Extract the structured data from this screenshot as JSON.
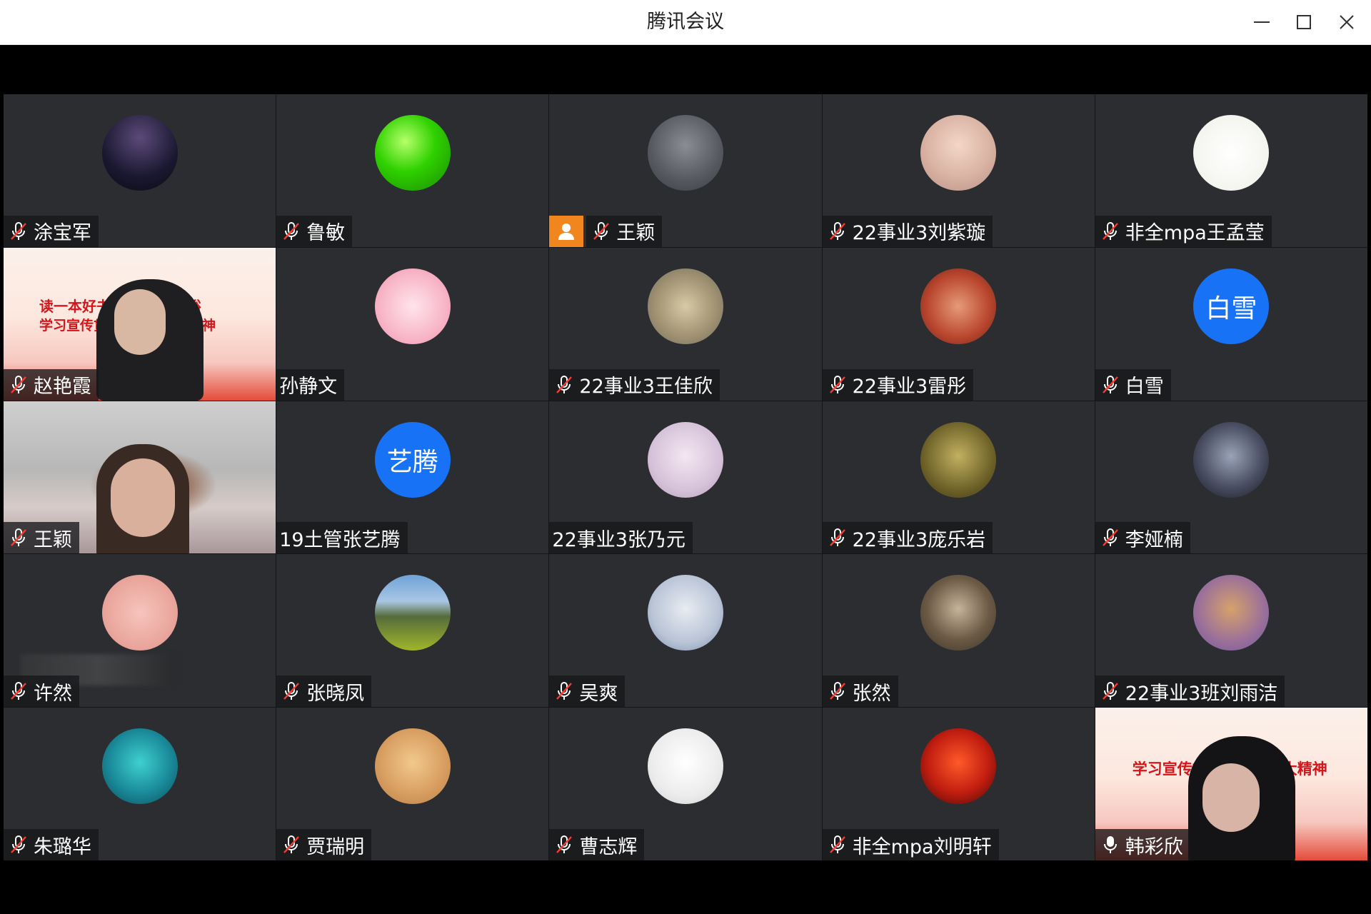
{
  "window": {
    "title": "腾讯会议",
    "controls": [
      "minimize-icon",
      "maximize-icon",
      "close-icon"
    ]
  },
  "colors": {
    "tile_bg": "#2b2d31",
    "host_badge": "#f0861d",
    "text_avatar": "#1772f5",
    "active_speaker_border": "#2fd07b"
  },
  "participants": [
    {
      "name": "涂宝军",
      "mic": "muted",
      "view": "avatar"
    },
    {
      "name": "鲁敏",
      "mic": "muted",
      "view": "avatar"
    },
    {
      "name": "王颖",
      "mic": "muted",
      "view": "avatar",
      "host": true
    },
    {
      "name": "22事业3刘紫璇",
      "mic": "muted",
      "view": "avatar"
    },
    {
      "name": "非全mpa王孟莹",
      "mic": "muted",
      "view": "avatar"
    },
    {
      "name": "赵艳霞",
      "mic": "muted",
      "view": "video"
    },
    {
      "name": "孙静文",
      "mic": "none",
      "view": "avatar"
    },
    {
      "name": "22事业3王佳欣",
      "mic": "muted",
      "view": "avatar"
    },
    {
      "name": "22事业3雷彤",
      "mic": "muted",
      "view": "avatar"
    },
    {
      "name": "白雪",
      "mic": "muted",
      "view": "text-avatar",
      "avatar_text": "白雪"
    },
    {
      "name": "王颖",
      "mic": "muted",
      "view": "video"
    },
    {
      "name": "19土管张艺腾",
      "mic": "none",
      "view": "text-avatar",
      "avatar_text": "艺腾"
    },
    {
      "name": "22事业3张乃元",
      "mic": "none",
      "view": "avatar"
    },
    {
      "name": "22事业3庞乐岩",
      "mic": "muted",
      "view": "avatar"
    },
    {
      "name": "李娅楠",
      "mic": "muted",
      "view": "avatar"
    },
    {
      "name": "许然",
      "mic": "muted",
      "view": "avatar"
    },
    {
      "name": "张晓凤",
      "mic": "muted",
      "view": "avatar"
    },
    {
      "name": "吴爽",
      "mic": "muted",
      "view": "avatar"
    },
    {
      "name": "张然",
      "mic": "muted",
      "view": "avatar"
    },
    {
      "name": "22事业3班刘雨洁",
      "mic": "muted",
      "view": "avatar"
    },
    {
      "name": "朱璐华",
      "mic": "muted",
      "view": "avatar"
    },
    {
      "name": "贾瑞明",
      "mic": "muted",
      "view": "avatar"
    },
    {
      "name": "曹志辉",
      "mic": "muted",
      "view": "avatar"
    },
    {
      "name": "非全mpa刘明轩",
      "mic": "muted",
      "view": "avatar"
    },
    {
      "name": "韩彩欣",
      "mic": "on",
      "view": "video",
      "active_speaker": true
    }
  ],
  "banners": {
    "tile6_line1": "读一本好书 走进共同富裕",
    "tile6_line2": "学习宣传贯彻党的二十大精神",
    "tile25_line1": "学习宣传贯彻党的二十大精神"
  }
}
